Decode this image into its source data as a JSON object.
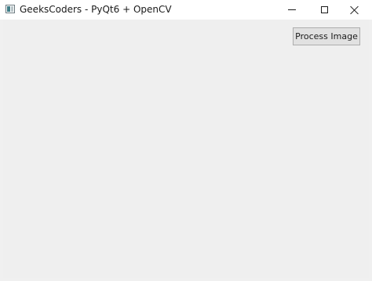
{
  "window": {
    "title": "GeeksCoders - PyQt6 + OpenCV",
    "icon": "app-window-icon",
    "controls": {
      "minimize_icon": "minimize-icon",
      "maximize_icon": "maximize-icon",
      "close_icon": "close-icon"
    }
  },
  "main": {
    "process_button_label": "Process Image"
  },
  "colors": {
    "client_background": "#efefef",
    "button_background": "#e1e1e1",
    "button_border": "#adadad",
    "titlebar": "#ffffff"
  }
}
